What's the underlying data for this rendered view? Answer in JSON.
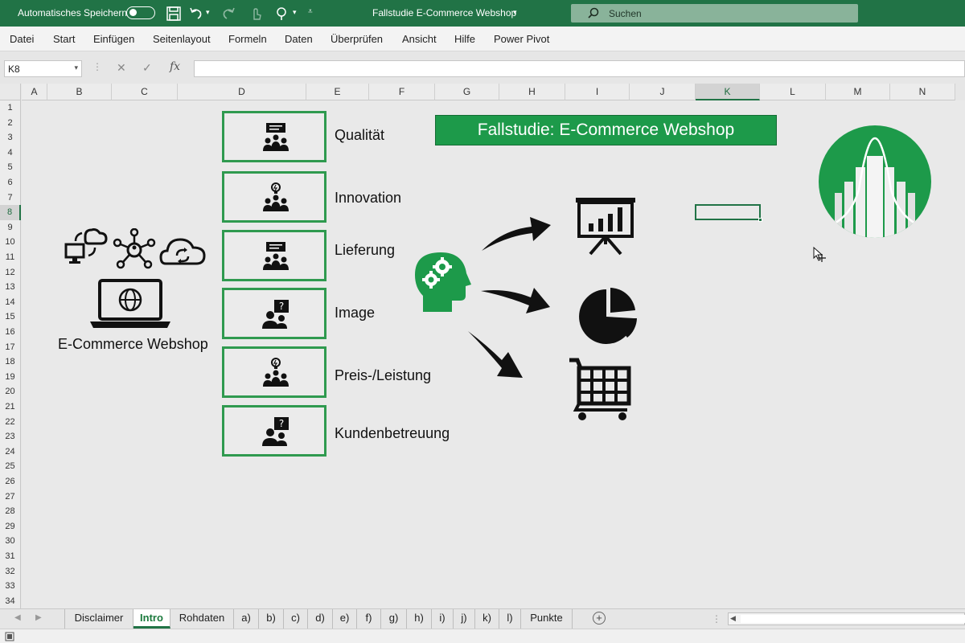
{
  "titlebar": {
    "autosave_label": "Automatisches Speichern",
    "document_title": "Fallstudie E-Commerce Webshop",
    "search_placeholder": "Suchen",
    "background_color": "#217346"
  },
  "menu": {
    "items": [
      "Datei",
      "Start",
      "Einfügen",
      "Seitenlayout",
      "Formeln",
      "Daten",
      "Überprüfen",
      "Ansicht",
      "Hilfe",
      "Power Pivot"
    ]
  },
  "formula_bar": {
    "name_box": "K8",
    "cancel_symbol": "✕",
    "enter_symbol": "✓",
    "fx_symbol": "fx",
    "formula": ""
  },
  "grid": {
    "columns": [
      "A",
      "B",
      "C",
      "D",
      "E",
      "F",
      "G",
      "H",
      "I",
      "J",
      "K",
      "L",
      "M",
      "N"
    ],
    "rows": [
      "1",
      "2",
      "3",
      "4",
      "5",
      "6",
      "7",
      "8",
      "9",
      "10",
      "11",
      "12",
      "13",
      "14",
      "15",
      "16",
      "17",
      "18",
      "19",
      "20",
      "21",
      "22",
      "23",
      "24",
      "25",
      "26",
      "27",
      "28",
      "29",
      "30",
      "31",
      "32",
      "33",
      "34"
    ],
    "selected_column": "K",
    "selected_row": "8"
  },
  "content": {
    "banner_title": "Fallstudie: E-Commerce Webshop",
    "webshop_label": "E-Commerce Webshop",
    "categories": [
      {
        "label": "Qualität",
        "icon": "team-presentation-icon"
      },
      {
        "label": "Innovation",
        "icon": "team-idea-icon"
      },
      {
        "label": "Lieferung",
        "icon": "team-presentation-icon"
      },
      {
        "label": "Image",
        "icon": "person-question-icon"
      },
      {
        "label": "Preis-/Leistung",
        "icon": "team-idea-icon"
      },
      {
        "label": "Kundenbetreuung",
        "icon": "person-question-icon"
      }
    ],
    "accent_color": "#1d9a4a"
  },
  "tabs": {
    "items": [
      "Disclaimer",
      "Intro",
      "Rohdaten",
      "a)",
      "b)",
      "c)",
      "d)",
      "e)",
      "f)",
      "g)",
      "h)",
      "i)",
      "j)",
      "k)",
      "l)",
      "Punkte"
    ],
    "active": "Intro",
    "add_symbol": "+"
  }
}
